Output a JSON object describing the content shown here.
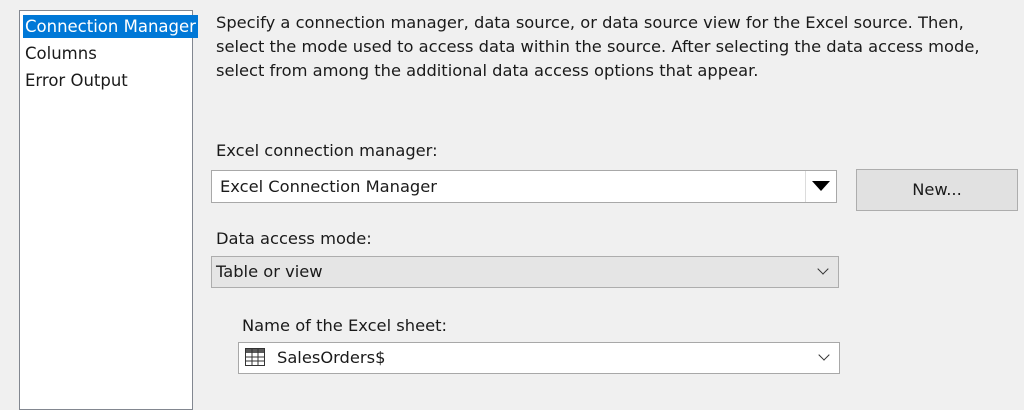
{
  "nav": {
    "items": [
      {
        "label": "Connection Manager",
        "selected": true
      },
      {
        "label": "Columns",
        "selected": false
      },
      {
        "label": "Error Output",
        "selected": false
      }
    ]
  },
  "description": "Specify a connection manager, data source, or data source view for the Excel source. Then, select the mode used to access data within the source. After selecting the data access mode, select from among the additional data access options that appear.",
  "connection": {
    "label": "Excel connection manager:",
    "value": "Excel Connection Manager",
    "new_button": "New..."
  },
  "access_mode": {
    "label": "Data access mode:",
    "value": "Table or view"
  },
  "sheet": {
    "label": "Name of the Excel sheet:",
    "value": "SalesOrders$",
    "icon": "table-icon"
  },
  "colors": {
    "selection": "#0078d7",
    "panel_background": "#f0f0f0"
  }
}
